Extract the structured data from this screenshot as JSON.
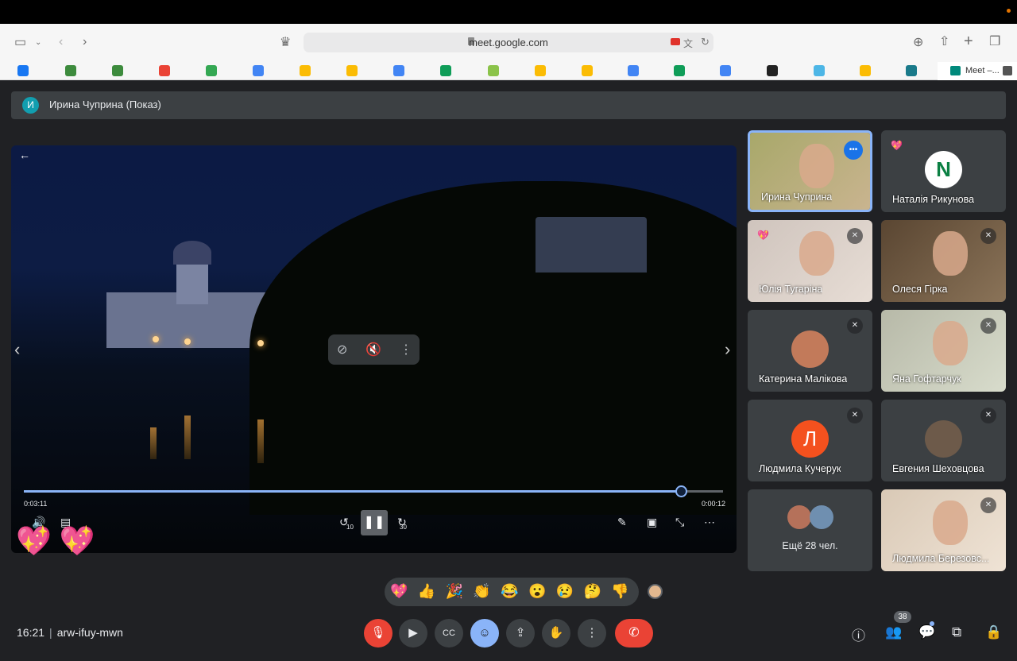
{
  "browser": {
    "url": "meet.google.com",
    "active_tab_label": "Meet –...",
    "bookmark_colors": [
      "#1877f2",
      "#3d8b3d",
      "#3d8b3d",
      "#ea4335",
      "#34a853",
      "#4285f4",
      "#fbbc04",
      "#fbbc04",
      "#4285f4",
      "#0f9d58",
      "#8bc34a",
      "#fbbc04",
      "#fbbc04",
      "#4285f4",
      "#0f9d58",
      "#4285f4",
      "#222222",
      "#4db6e6",
      "#fbbc04",
      "#1a7a8a"
    ]
  },
  "presenter": {
    "initial": "И",
    "label": "Ирина Чуприна (Показ)"
  },
  "video": {
    "elapsed": "0:03:11",
    "remaining": "0:00:12",
    "progress": 0.94,
    "rewind_label": "10",
    "forward_label": "30"
  },
  "participants": [
    {
      "name": "Ирина Чуприна",
      "speaking": true,
      "photo_colors": [
        "#a8a86a",
        "#c9b48f"
      ]
    },
    {
      "name": "Наталія Рикунова",
      "avatar_letter": "N",
      "avatar_color": "#ffffff",
      "reaction": "💖"
    },
    {
      "name": "Юлія Тугаріна",
      "muted": true,
      "reaction": "💖",
      "photo_colors": [
        "#cfc4bd",
        "#e7ddd5"
      ]
    },
    {
      "name": "Олеся Гірка",
      "muted": true,
      "photo_colors": [
        "#5a4632",
        "#8a7358"
      ]
    },
    {
      "name": "Катерина Малікова",
      "muted": true,
      "avatar_color": "#c27a5a"
    },
    {
      "name": "Яна Гофтарчук",
      "muted": true,
      "photo_colors": [
        "#b7b9a8",
        "#d8dccc"
      ]
    },
    {
      "name": "Людмила Кучерук",
      "muted": true,
      "avatar_letter": "Л",
      "avatar_color": "#f4511e"
    },
    {
      "name": "Евгения Шеховцова",
      "muted": true,
      "avatar_color": "#6d5a4a"
    },
    {
      "name": "Ещё 28 чел.",
      "group": true
    },
    {
      "name": "Людмила Березовс...",
      "muted": true,
      "photo_colors": [
        "#d9c9b6",
        "#efe3d5"
      ]
    }
  ],
  "reactions": [
    "💖",
    "👍",
    "🎉",
    "👏",
    "😂",
    "😮",
    "😢",
    "🤔",
    "👎"
  ],
  "meeting": {
    "time": "16:21",
    "code": "arw-ifuy-mwn",
    "people_count": "38"
  }
}
